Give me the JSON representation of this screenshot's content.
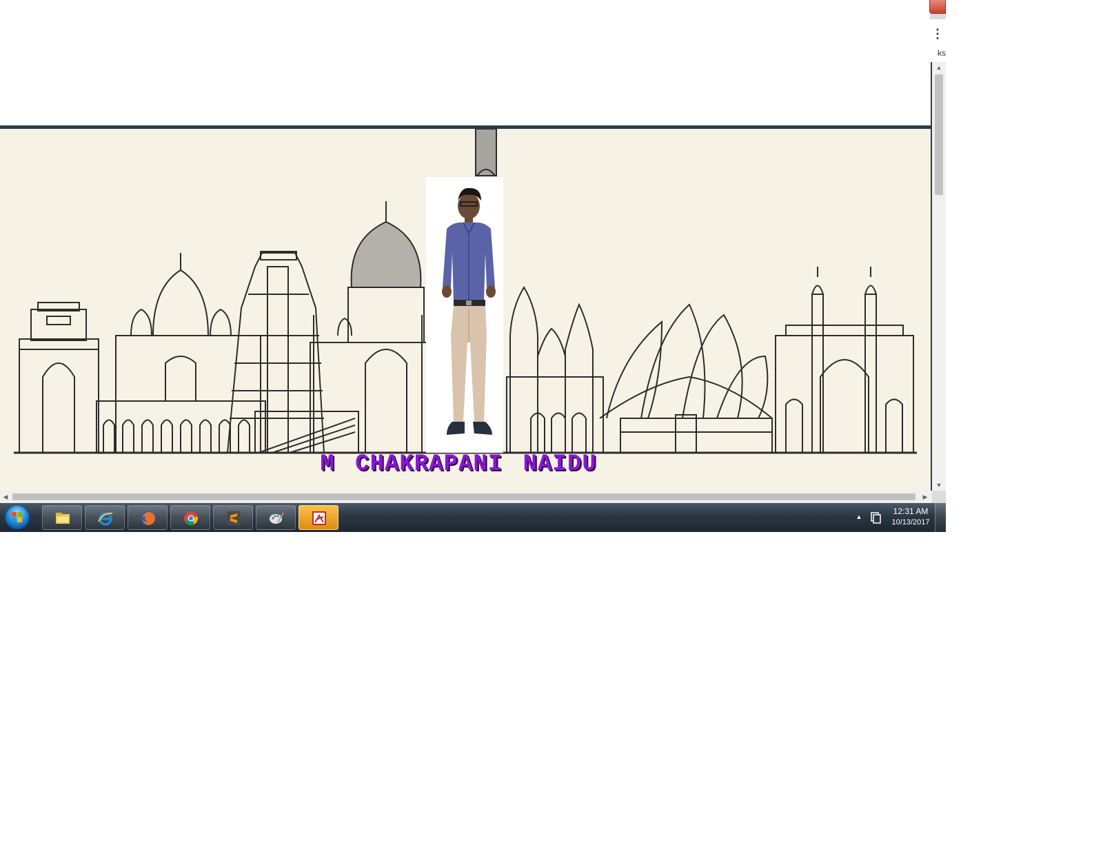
{
  "browser": {
    "menu_icon": "⋮",
    "bookmarks_fragment": "ks"
  },
  "page": {
    "banner_name": "M  CHAKRAPANI  NAIDU",
    "name_color": "#8a16d6",
    "header_border_color": "#2f3a47",
    "banner_background": "#f6f2e6"
  },
  "scrollbars": {
    "up_arrow": "▲",
    "down_arrow": "▼",
    "left_arrow": "◀",
    "right_arrow": "▶"
  },
  "taskbar": {
    "pinned": [
      {
        "name": "windows-explorer",
        "icon": "folder-icon"
      },
      {
        "name": "internet-explorer",
        "icon": "ie-icon"
      },
      {
        "name": "firefox",
        "icon": "firefox-icon"
      },
      {
        "name": "chrome",
        "icon": "chrome-icon"
      },
      {
        "name": "sublime-text",
        "icon": "sublime-icon"
      },
      {
        "name": "paint",
        "icon": "paint-icon"
      },
      {
        "name": "acrobat",
        "icon": "acrobat-icon",
        "active": true
      }
    ],
    "tray_arrow": "▲",
    "clock": {
      "time": "12:31 AM",
      "date": "10/13/2017"
    }
  }
}
